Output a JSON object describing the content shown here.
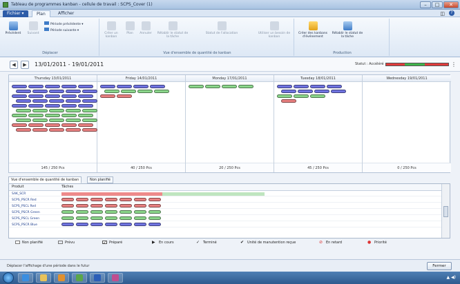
{
  "window": {
    "title": "Tableau de programmes kanban - cellule de travail : SCPS_Cover (1)",
    "min": "–",
    "max": "□",
    "close": "✕"
  },
  "ribbon_tabs": [
    "Fichier ▾",
    "Plan",
    "Afficher"
  ],
  "ribbon": {
    "groups": [
      {
        "label": "Déplacer",
        "buttons": [
          "Précédent",
          "Suivant",
          "Période précédente ▾",
          "Période suivante ▾"
        ]
      },
      {
        "label": "Vue d'ensemble de quantité de kanban",
        "buttons": [
          "Créer un kanban",
          "Plan",
          "Annuler",
          "Rétablir le statut de la tâche",
          "Statut de l'allocation",
          "Utiliser un besoin de kanban"
        ]
      },
      {
        "label": "Production",
        "buttons": [
          "Créer des kanbans d'événement",
          "Rétablir le statut de la tâche"
        ]
      }
    ]
  },
  "navbar": {
    "prev": "◀",
    "next": "▶",
    "date_range": "13/01/2011 - 19/01/2011",
    "status_label": "Statut : Accéléré",
    "status_colors": [
      "#e03b3b",
      "#3fb44b",
      "#e03b3b"
    ]
  },
  "days": [
    {
      "label": "Thursday 13/01/2011",
      "footer": "145 / 250 Pcs"
    },
    {
      "label": "Friday 14/01/2011",
      "footer": "40 / 250 Pcs"
    },
    {
      "label": "Monday 17/01/2011",
      "footer": "20 / 250 Pcs"
    },
    {
      "label": "Tuesday 18/01/2011",
      "footer": "45 / 250 Pcs"
    },
    {
      "label": "Wednesday 19/01/2011",
      "footer": "0 / 250 Pcs"
    }
  ],
  "kanban_colors": {
    "blue": "#6f73e0",
    "green": "#8bd68b",
    "red": "#e88080"
  },
  "subtabs": [
    "Vue d'ensemble de quantité de kanban",
    "Non planifié"
  ],
  "grid": {
    "headers": [
      "Produit",
      "Tâches"
    ],
    "rows": [
      {
        "product": "SAK_SCR",
        "color": ""
      },
      {
        "product": "SCPS_PSCR  Red",
        "color": "red"
      },
      {
        "product": "SCPS_PSCL  Red",
        "color": "red"
      },
      {
        "product": "SCPS_PSCR  Green",
        "color": "green"
      },
      {
        "product": "SCPS_PSCL  Green",
        "color": "green"
      },
      {
        "product": "SCPS_PSCR  Blue",
        "color": "blue"
      }
    ]
  },
  "legend": [
    {
      "label": "Non planifié",
      "icon": "unplanned-icon"
    },
    {
      "label": "Prévu",
      "icon": "planned-icon"
    },
    {
      "label": "Préparé",
      "icon": "prepared-icon"
    },
    {
      "label": "En cours",
      "icon": "in-progress-icon"
    },
    {
      "label": "Terminé",
      "icon": "completed-icon"
    },
    {
      "label": "Unité de manutention reçue",
      "icon": "received-icon"
    },
    {
      "label": "En retard",
      "icon": "late-icon"
    },
    {
      "label": "Priorité",
      "icon": "priority-icon"
    }
  ],
  "status": {
    "message": "Déplacer l'affichage d'une période dans le futur",
    "close_button": "Fermer"
  },
  "taskbar": {
    "tray": "▲ ◀)"
  }
}
